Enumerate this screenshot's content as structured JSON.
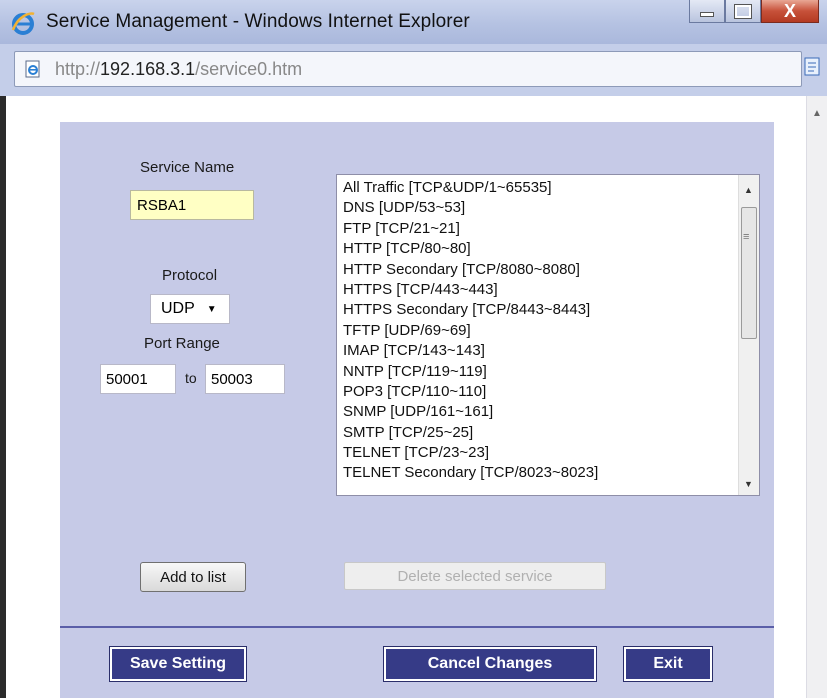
{
  "window": {
    "title": "Service Management - Windows Internet Explorer",
    "close_glyph": "X"
  },
  "addressbar": {
    "url_prefix": "http://",
    "url_host": "192.168.3.1",
    "url_path": "/service0.htm"
  },
  "form": {
    "service_name_label": "Service Name",
    "service_name_value": "RSBA1",
    "protocol_label": "Protocol",
    "protocol_value": "UDP",
    "port_range_label": "Port Range",
    "port_start": "50001",
    "port_to_label": "to",
    "port_end": "50003"
  },
  "services": [
    "All Traffic [TCP&UDP/1~65535]",
    "DNS [UDP/53~53]",
    "FTP [TCP/21~21]",
    "HTTP [TCP/80~80]",
    "HTTP Secondary [TCP/8080~8080]",
    "HTTPS [TCP/443~443]",
    "HTTPS Secondary [TCP/8443~8443]",
    "TFTP [UDP/69~69]",
    "IMAP [TCP/143~143]",
    "NNTP [TCP/119~119]",
    "POP3 [TCP/110~110]",
    "SNMP [UDP/161~161]",
    "SMTP [TCP/25~25]",
    "TELNET [TCP/23~23]",
    "TELNET Secondary [TCP/8023~8023]"
  ],
  "buttons": {
    "add_to_list": "Add to list",
    "delete_selected": "Delete selected service",
    "save_setting": "Save Setting",
    "cancel_changes": "Cancel Changes",
    "exit": "Exit"
  },
  "colors": {
    "panel_bg": "#c6cae7",
    "button_navy": "#363b87",
    "service_input_bg": "#ffffc4"
  },
  "icons": [
    "ie-logo-icon",
    "page-icon",
    "compatibility-view-icon",
    "minimize-icon",
    "maximize-icon",
    "close-icon",
    "dropdown-caret-icon",
    "scroll-up-icon",
    "scroll-down-icon"
  ]
}
